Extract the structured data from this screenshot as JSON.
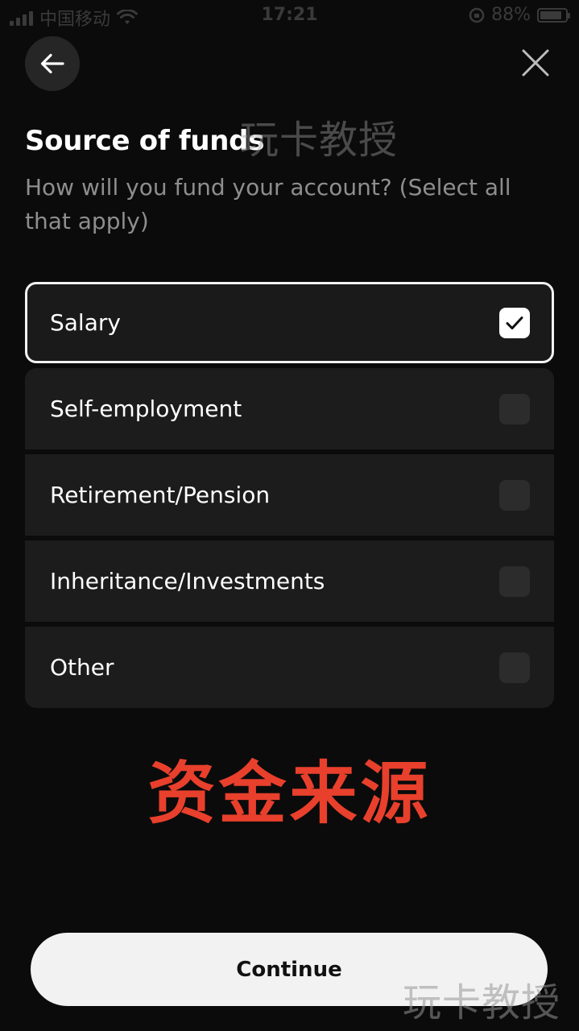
{
  "status_bar": {
    "carrier": "中国移动",
    "time": "17:21",
    "battery_text": "88%",
    "battery_level": 0.88
  },
  "nav": {
    "back_icon": "arrow-left-icon",
    "close_icon": "close-icon"
  },
  "header": {
    "title": "Source of funds",
    "subtitle": "How will you fund your account? (Select all that apply)"
  },
  "options": [
    {
      "label": "Salary",
      "checked": true
    },
    {
      "label": "Self-employment",
      "checked": false
    },
    {
      "label": "Retirement/Pension",
      "checked": false
    },
    {
      "label": "Inheritance/Investments",
      "checked": false
    },
    {
      "label": "Other",
      "checked": false
    }
  ],
  "overlay": {
    "caption": "资金来源",
    "watermark": "玩卡教授",
    "caption_color": "#e8402c"
  },
  "footer": {
    "continue_label": "Continue"
  },
  "colors": {
    "background": "#0b0b0b",
    "option_bg": "#1c1c1c",
    "selected_border": "#f2f2f2",
    "button_bg": "#f2f2f2"
  }
}
